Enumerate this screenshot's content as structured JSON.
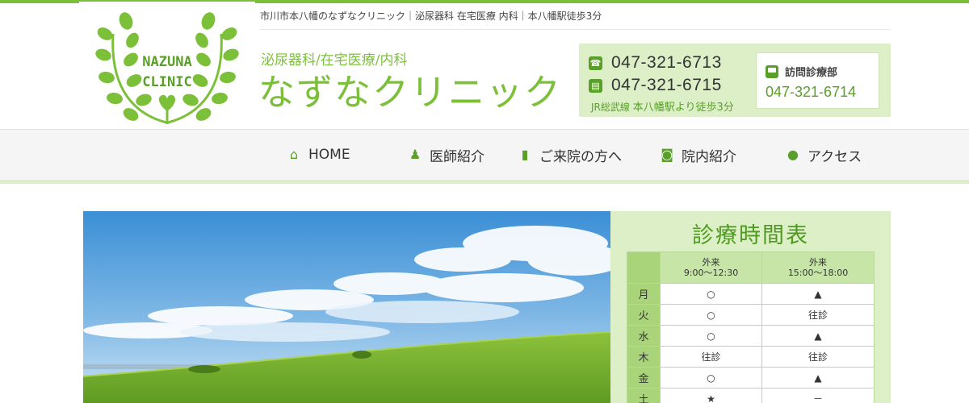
{
  "header": {
    "tagline": "市川市本八幡のなずなクリニック｜泌尿器科 在宅医療 内科｜本八幡駅徒歩3分",
    "logo_line1": "NAZUNA",
    "logo_line2": "CLINIC",
    "subtitle": "泌尿器科/在宅医療/内科",
    "clinic_name": "なずなクリニック"
  },
  "contact": {
    "phone": "047-321-6713",
    "fax": "047-321-6715",
    "access_prefix": "JR総武線 ",
    "access_emph": "本八幡駅より徒歩3分",
    "visit_label": "訪問診療部",
    "visit_phone": "047-321-6714"
  },
  "nav": [
    {
      "label": "HOME",
      "icon": "home-icon"
    },
    {
      "label": "医師紹介",
      "icon": "doctor-icon"
    },
    {
      "label": "ご来院の方へ",
      "icon": "book-icon"
    },
    {
      "label": "院内紹介",
      "icon": "camera-icon"
    },
    {
      "label": "アクセス",
      "icon": "map-marker-icon"
    }
  ],
  "schedule": {
    "title": "診療時間表",
    "col1": {
      "name": "外来",
      "time": "9:00～12:30"
    },
    "col2": {
      "name": "外来",
      "time": "15:00～18:00"
    },
    "rows": [
      {
        "day": "月",
        "am": "○",
        "pm": "▲"
      },
      {
        "day": "火",
        "am": "○",
        "pm": "往診"
      },
      {
        "day": "水",
        "am": "○",
        "pm": "▲"
      },
      {
        "day": "木",
        "am": "往診",
        "pm": "往診"
      },
      {
        "day": "金",
        "am": "○",
        "pm": "▲"
      },
      {
        "day": "土",
        "am": "★",
        "pm": "－"
      }
    ]
  },
  "colors": {
    "accent": "#7cc03a",
    "accent_dark": "#5a9f2a",
    "panel": "#dcefc6"
  }
}
